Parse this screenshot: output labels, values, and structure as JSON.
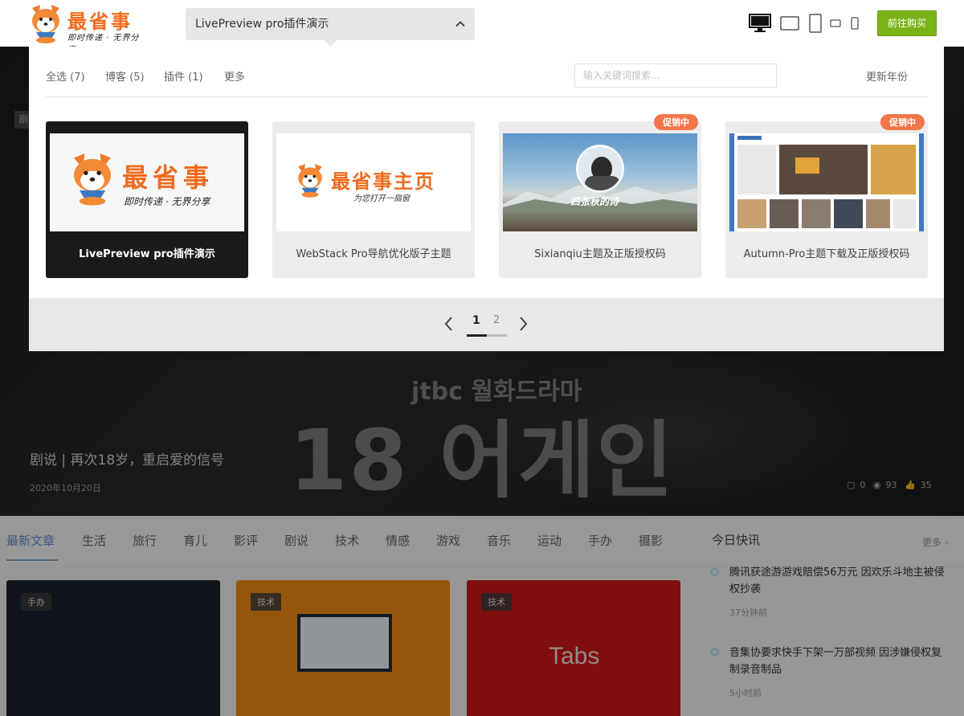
{
  "header": {
    "brand": "最省事",
    "slogan": "即时传递 · 无界分享",
    "selected_theme": "LivePreview pro插件演示",
    "buy_label": "前往购买",
    "devices": [
      "desktop-icon",
      "tablet-landscape-icon",
      "tablet-portrait-icon",
      "phone-landscape-icon",
      "phone-portrait-icon"
    ]
  },
  "panel": {
    "filters": [
      {
        "label": "全选 (7)"
      },
      {
        "label": "博客 (5)"
      },
      {
        "label": "插件 (1)"
      },
      {
        "label": "更多"
      }
    ],
    "search_placeholder": "输入关键词搜索...",
    "year_filter": "更新年份",
    "themes": [
      {
        "name": "LivePreview pro插件演示",
        "promo": ""
      },
      {
        "name": "WebStack Pro导航优化版子主题",
        "promo": ""
      },
      {
        "name": "Sixianqiu主题及正版授权码",
        "promo": "促销中"
      },
      {
        "name": "Autumn-Pro主题下载及正版授权码",
        "promo": "促销中"
      }
    ],
    "thumb_texts": {
      "logo_brand": "最省事",
      "logo_slogan": "即时传递 · 无界分享",
      "home_brand": "最省事主页",
      "home_slogan": "为您打开一扇窗",
      "sixianqiu_title": "四张秋的诗"
    },
    "pagination": {
      "current": "1",
      "next": "2",
      "progress": 0.5
    }
  },
  "background": {
    "hero_title": "剧说 | 再次18岁，重启爱的信号",
    "hero_date": "2020年10月20日",
    "hero_comments": "0",
    "hero_views": "93",
    "hero_likes": "35",
    "categories": [
      "最新文章",
      "生活",
      "旅行",
      "育儿",
      "影评",
      "剧说",
      "技术",
      "情感",
      "游戏",
      "音乐",
      "运动",
      "手办",
      "摄影"
    ],
    "news_header": "今日快讯",
    "news_more": "更多 ›",
    "news": [
      {
        "text": "腾讯获途游游戏赔偿56万元 因欢乐斗地主被侵权抄袭",
        "time": "37分钟前"
      },
      {
        "text": "音集协要求快手下架一万部视频 因涉嫌侵权复制录音制品",
        "time": "5小时前"
      }
    ],
    "cards": [
      {
        "tag": "手办",
        "color": "#1c2230"
      },
      {
        "tag": "技术",
        "color": "#f08c14"
      },
      {
        "tag": "技术",
        "color": "#d01818",
        "label": "Tabs"
      }
    ]
  }
}
